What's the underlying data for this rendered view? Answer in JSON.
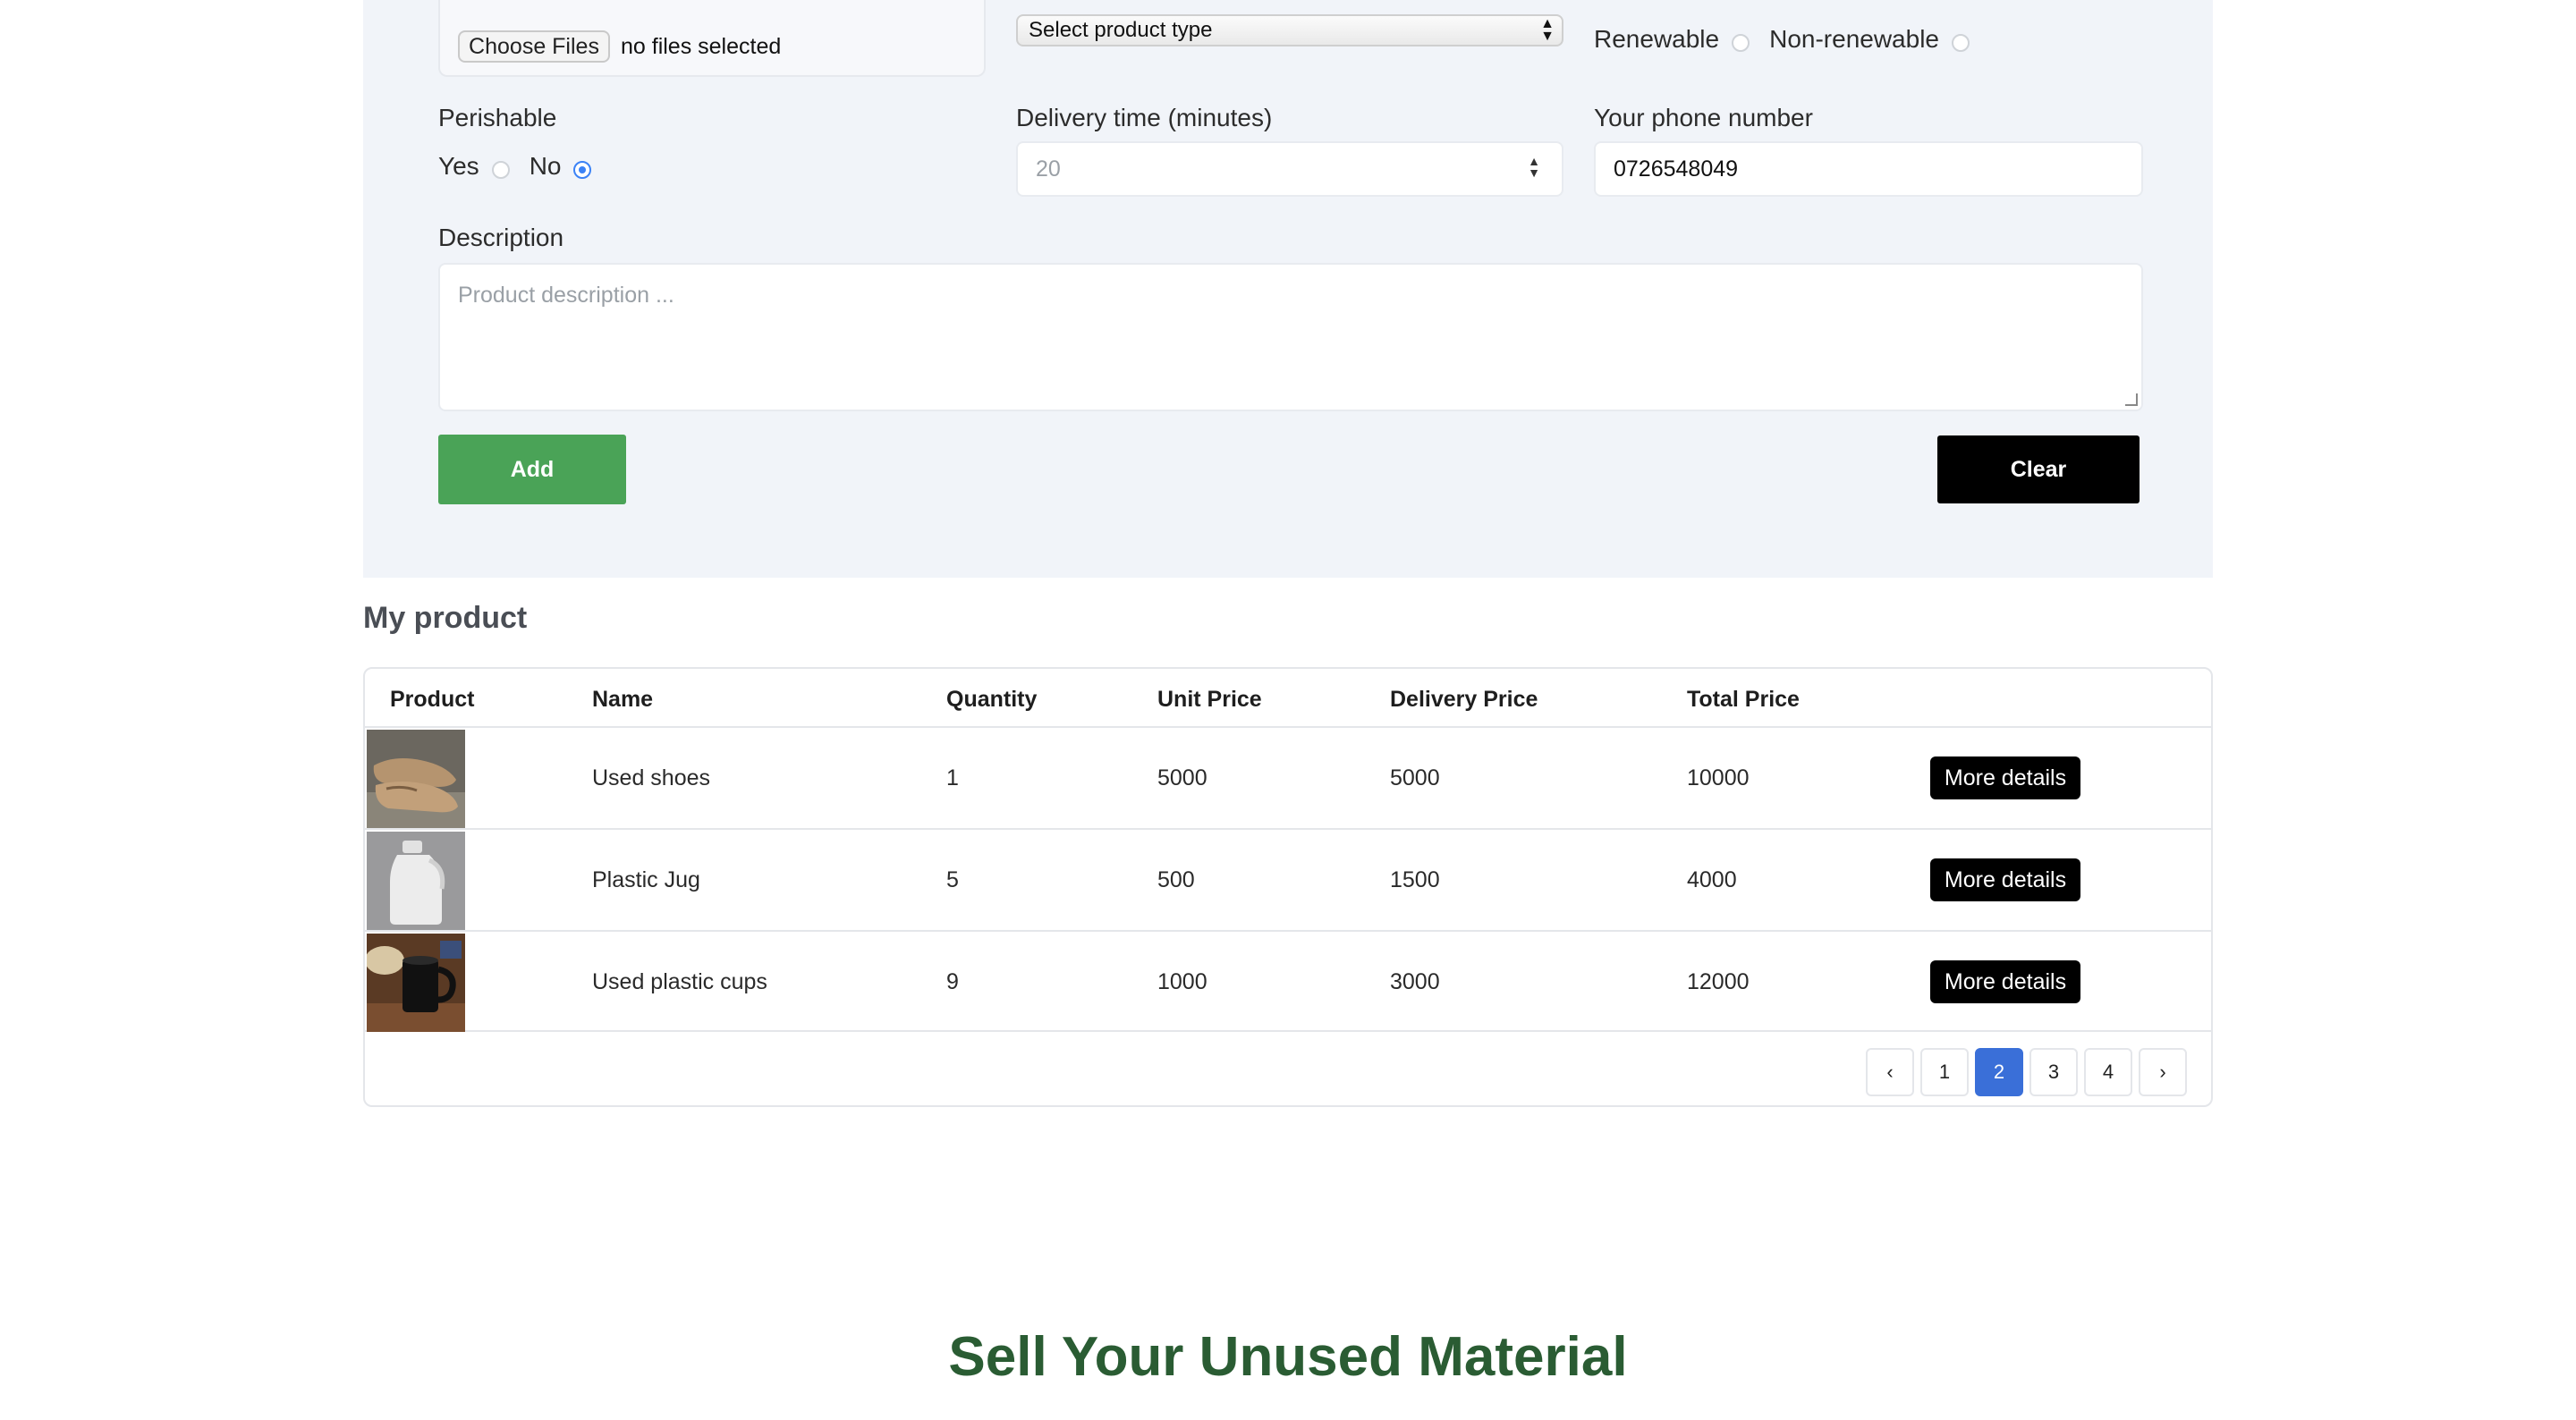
{
  "form": {
    "file_input": {
      "button_label": "Choose Files",
      "status": "no files selected"
    },
    "product_type": {
      "selected": "Select product type"
    },
    "category": {
      "options": [
        "Renewable",
        "Non-renewable"
      ]
    },
    "perishable": {
      "label": "Perishable",
      "options": [
        "Yes",
        "No"
      ],
      "selected": "No"
    },
    "delivery_time": {
      "label": "Delivery time (minutes)",
      "placeholder": "20"
    },
    "phone": {
      "label": "Your phone number",
      "value": "0726548049"
    },
    "description": {
      "label": "Description",
      "placeholder": "Product description ..."
    },
    "add_label": "Add",
    "clear_label": "Clear"
  },
  "products": {
    "title": "My product",
    "columns": [
      "Product",
      "Name",
      "Quantity",
      "Unit Price",
      "Delivery Price",
      "Total Price"
    ],
    "rows": [
      {
        "image": "shoes-image",
        "name": "Used shoes",
        "quantity": "1",
        "unit_price": "5000",
        "delivery_price": "5000",
        "total_price": "10000",
        "action": "More details"
      },
      {
        "image": "jug-image",
        "name": "Plastic Jug",
        "quantity": "5",
        "unit_price": "500",
        "delivery_price": "1500",
        "total_price": "4000",
        "action": "More details"
      },
      {
        "image": "mug-image",
        "name": "Used plastic cups",
        "quantity": "9",
        "unit_price": "1000",
        "delivery_price": "3000",
        "total_price": "12000",
        "action": "More details"
      }
    ],
    "pagination": {
      "prev": "‹",
      "pages": [
        "1",
        "2",
        "3",
        "4"
      ],
      "current": "2",
      "next": "›"
    }
  },
  "promo": {
    "title": "Sell Your Unused Material"
  },
  "colors": {
    "accent_green": "#4aa357",
    "page_active": "#3a6fd8",
    "promo_title": "#2a5c33",
    "panel_bg": "#f1f4f9"
  }
}
